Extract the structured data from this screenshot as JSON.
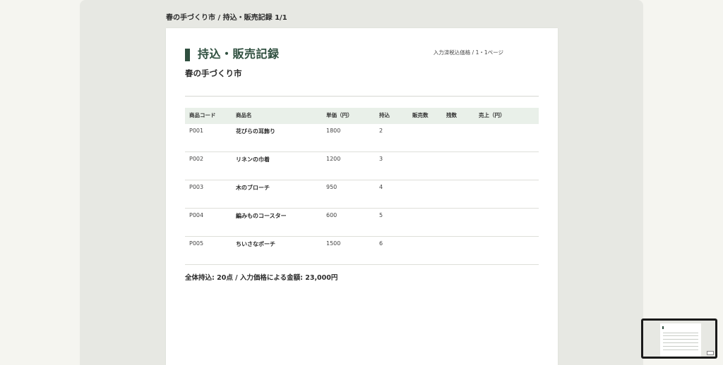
{
  "caption": "春の手づくり市 / 持込・販売記録 1/1",
  "document": {
    "title": "持込・販売記録",
    "meta": "入力済税込価格 / 1・1ページ",
    "subtitle": "春の手づくり市",
    "table": {
      "headers": [
        "商品コード",
        "商品名",
        "単価（円）",
        "持込",
        "販売数",
        "残数",
        "売上（円）"
      ],
      "rows": [
        {
          "code": "P001",
          "name": "花びらの耳飾り",
          "price": "1800",
          "qty": "2",
          "sold": "",
          "remain": "",
          "sales": ""
        },
        {
          "code": "P002",
          "name": "リネンの巾着",
          "price": "1200",
          "qty": "3",
          "sold": "",
          "remain": "",
          "sales": ""
        },
        {
          "code": "P003",
          "name": "木のブローチ",
          "price": "950",
          "qty": "4",
          "sold": "",
          "remain": "",
          "sales": ""
        },
        {
          "code": "P004",
          "name": "編みものコースター",
          "price": "600",
          "qty": "5",
          "sold": "",
          "remain": "",
          "sales": ""
        },
        {
          "code": "P005",
          "name": "ちいさなポーチ",
          "price": "1500",
          "qty": "6",
          "sold": "",
          "remain": "",
          "sales": ""
        }
      ]
    },
    "summary": "全体持込: 20点 / 入力価格による金額: 23,000円"
  },
  "colors": {
    "accent": "#2f4f3f",
    "header_bg": "#e9f0e9",
    "stage_bg": "#e7e8e3",
    "page_bg": "#f5f5f0"
  },
  "thumbnail": {
    "icon": "page-thumbnail-icon"
  }
}
